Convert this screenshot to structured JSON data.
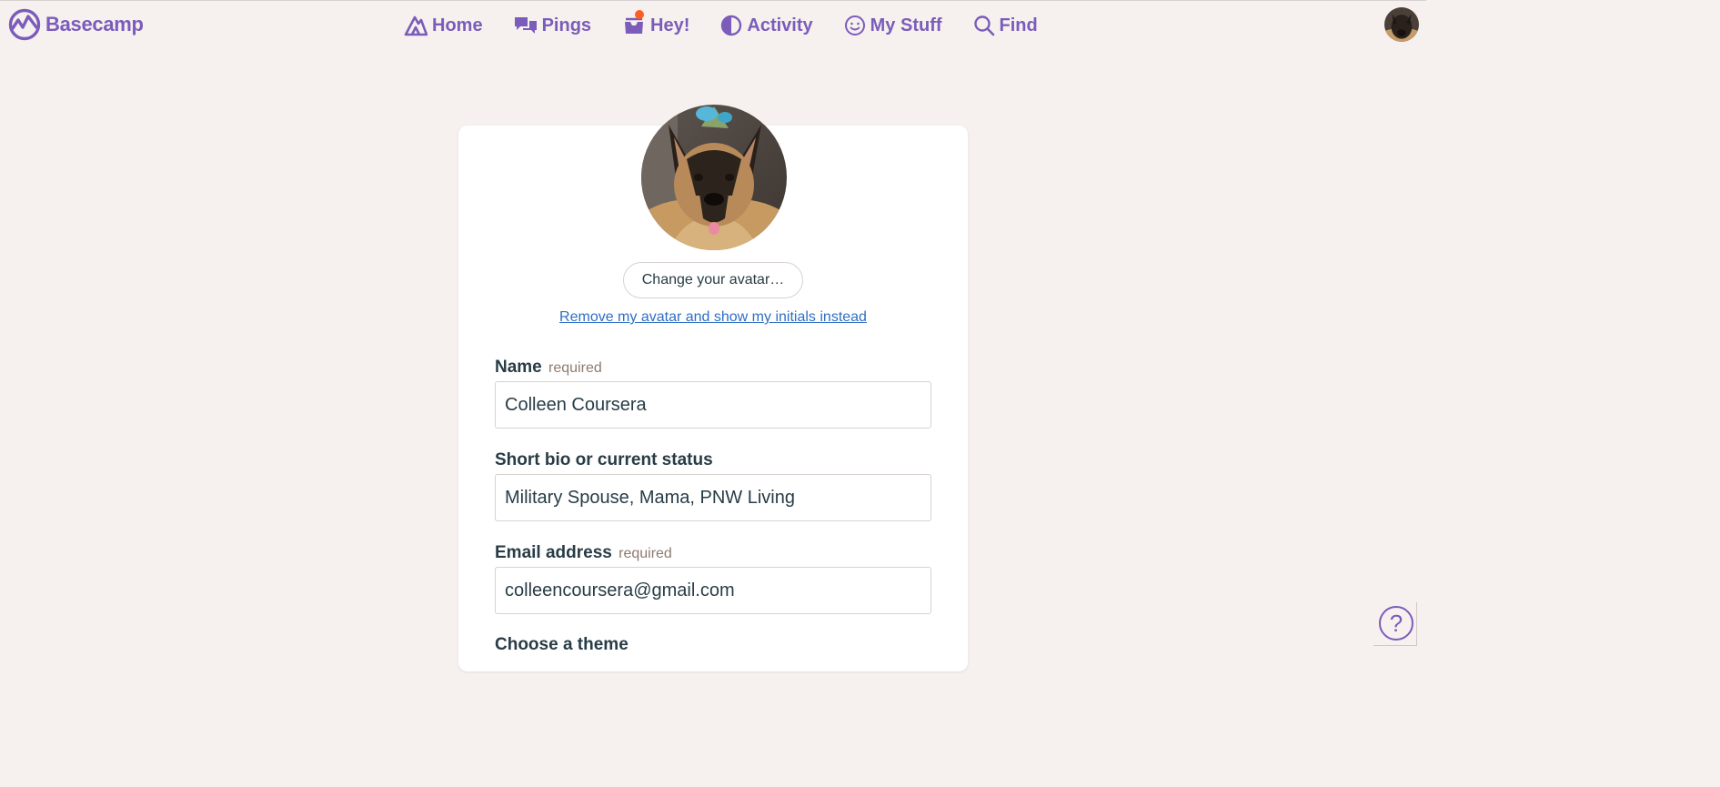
{
  "app": {
    "brand": "Basecamp",
    "colors": {
      "accent": "#7b5cba",
      "background": "#f6f1ee",
      "link": "#2f6fc6",
      "notification": "#ff5d23"
    }
  },
  "nav": {
    "items": [
      {
        "label": "Home",
        "icon": "home-icon"
      },
      {
        "label": "Pings",
        "icon": "pings-icon"
      },
      {
        "label": "Hey!",
        "icon": "hey-inbox-icon",
        "has_notification": true
      },
      {
        "label": "Activity",
        "icon": "activity-icon"
      },
      {
        "label": "My Stuff",
        "icon": "my-stuff-icon"
      },
      {
        "label": "Find",
        "icon": "search-icon"
      }
    ]
  },
  "profile": {
    "change_avatar_label": "Change your avatar…",
    "remove_avatar_label": "Remove my avatar and show my initials instead",
    "fields": {
      "name": {
        "label": "Name",
        "hint": "required",
        "value": "Colleen Coursera"
      },
      "bio": {
        "label": "Short bio or current status",
        "value": "Military Spouse, Mama, PNW Living"
      },
      "email": {
        "label": "Email address",
        "hint": "required",
        "value": "colleencoursera@gmail.com"
      }
    },
    "theme_heading": "Choose a theme"
  },
  "help": {
    "label": "?"
  }
}
